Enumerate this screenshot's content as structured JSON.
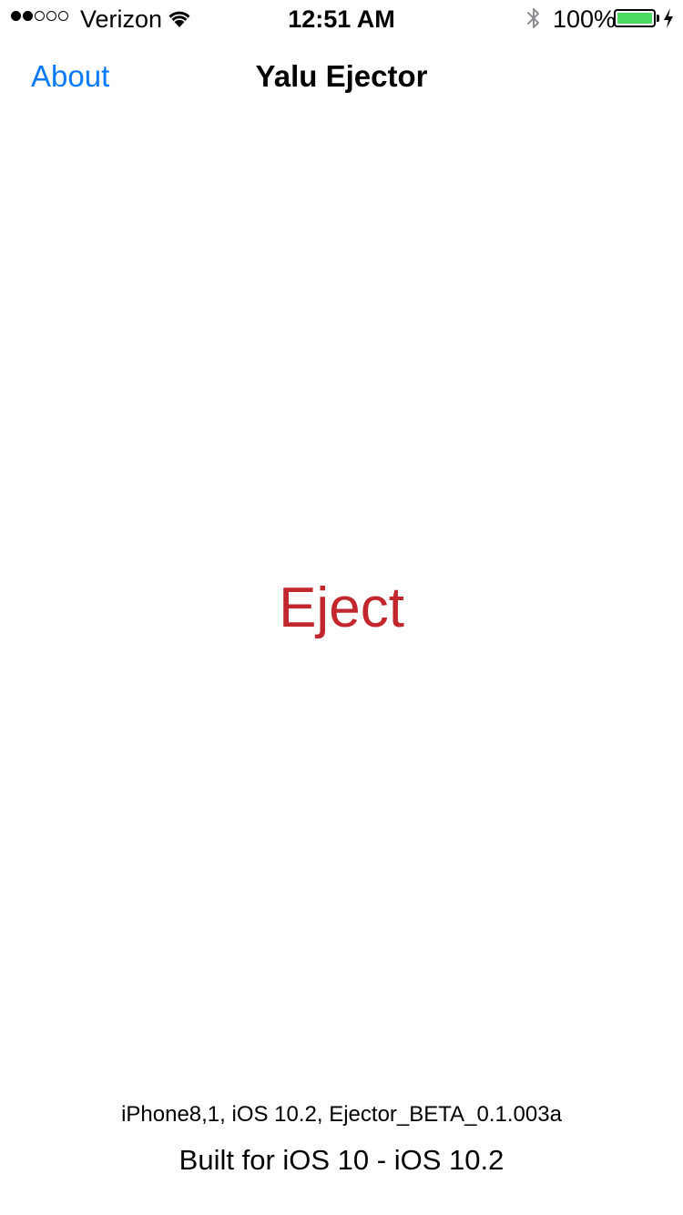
{
  "status_bar": {
    "signal_bars_filled": 2,
    "signal_bars_total": 5,
    "carrier": "Verizon",
    "time": "12:51 AM",
    "battery_percent_label": "100%",
    "battery_level": 1.0,
    "icons": [
      "wifi-icon",
      "bluetooth-icon",
      "battery-icon",
      "charging-bolt-icon"
    ],
    "colors": {
      "battery_fill": "#4cd964"
    }
  },
  "nav": {
    "left_button": "About",
    "title": "Yalu Ejector",
    "colors": {
      "link": "#0a7aff"
    }
  },
  "main": {
    "action_button": "Eject",
    "colors": {
      "action": "#c1272d"
    }
  },
  "footer": {
    "device_info": "iPhone8,1, iOS 10.2, Ejector_BETA_0.1.003a",
    "built_for": "Built for iOS 10 - iOS 10.2"
  }
}
